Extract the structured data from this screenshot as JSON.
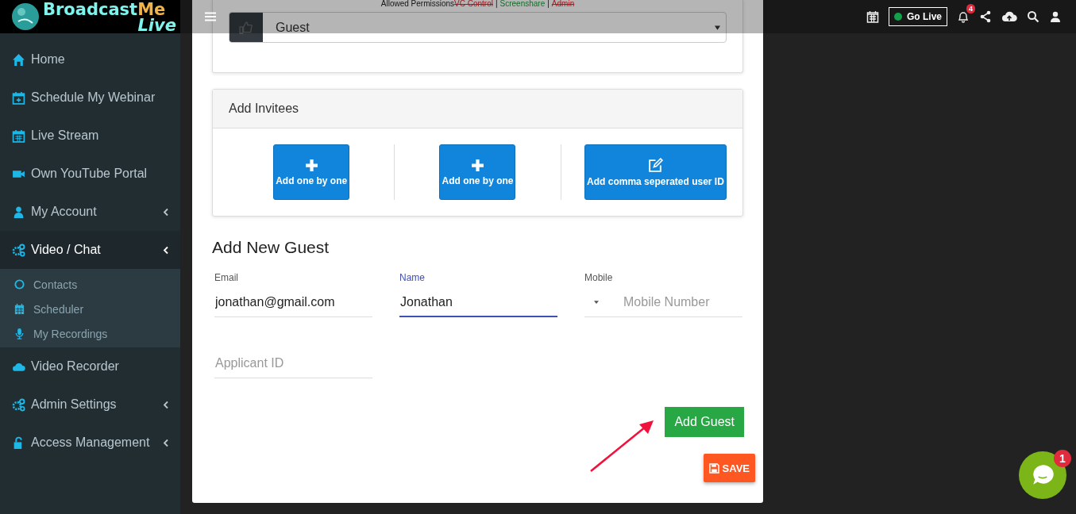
{
  "logo": {
    "word_1": "Broadcast",
    "word_2": "Me",
    "word_3": "Live"
  },
  "topbar": {
    "go_live": "Go Live",
    "notifications_badge": "4"
  },
  "sidebar": {
    "items": [
      {
        "label": "Home",
        "selected": false,
        "has_submenu": false
      },
      {
        "label": "Schedule My Webinar",
        "selected": false,
        "has_submenu": false
      },
      {
        "label": "Live Stream",
        "selected": false,
        "has_submenu": false
      },
      {
        "label": "Own YouTube Portal",
        "selected": false,
        "has_submenu": false
      },
      {
        "label": "My Account",
        "selected": false,
        "has_submenu": true
      },
      {
        "label": "Video / Chat",
        "selected": true,
        "has_submenu": true,
        "children": [
          {
            "label": "Contacts"
          },
          {
            "label": "Scheduler"
          },
          {
            "label": "My Recordings"
          }
        ]
      },
      {
        "label": "Video Recorder",
        "selected": false,
        "has_submenu": false
      },
      {
        "label": "Admin Settings",
        "selected": false,
        "has_submenu": true
      },
      {
        "label": "Access Management",
        "selected": false,
        "has_submenu": true
      }
    ]
  },
  "role_card": {
    "permissions_label": "Allowed Permissions",
    "permissions": [
      {
        "label": "VC Control",
        "enabled": false
      },
      {
        "label": "Screenshare",
        "enabled": true
      },
      {
        "label": "Admin",
        "enabled": false
      }
    ],
    "separator": "|",
    "role_value": "Guest"
  },
  "invitees": {
    "title": "Add Invitees",
    "buttons": [
      {
        "label": "Add one by one"
      },
      {
        "label": "Add one by one"
      },
      {
        "label": "Add comma seperated user ID"
      }
    ]
  },
  "guest_form": {
    "title": "Add New Guest",
    "fields": [
      {
        "kind": "text",
        "label": "Email",
        "value": "jonathan@gmail.com",
        "focused": false
      },
      {
        "kind": "text",
        "label": "Name",
        "value": "Jonathan",
        "focused": true
      },
      {
        "kind": "phone",
        "label": "Mobile",
        "placeholder": "Mobile Number",
        "focused": false
      },
      {
        "kind": "text",
        "placeholder": "Applicant ID",
        "focused": false
      }
    ],
    "add_button": "Add Guest",
    "save_button": "SAVE"
  },
  "chat_widget": {
    "badge": "1"
  }
}
